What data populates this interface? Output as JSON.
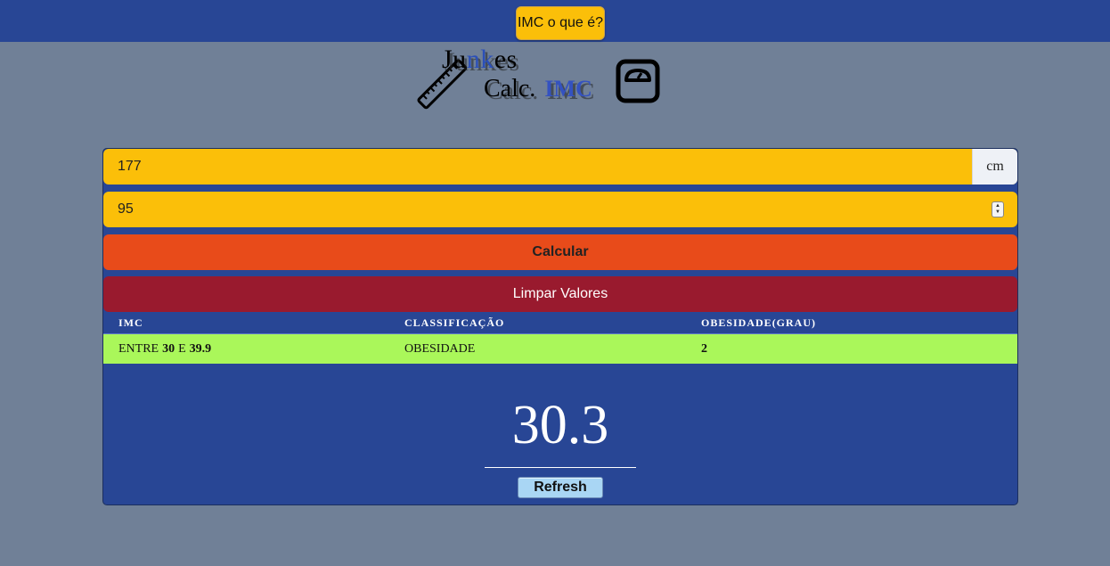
{
  "nav": {
    "imc_button_label": "IMC o que é?"
  },
  "logo": {
    "line1_a": "Ju",
    "line1_b": "nk",
    "line1_c": "es",
    "line2": "Calc.",
    "line2_imc": "IMC"
  },
  "form": {
    "height_value": "177",
    "height_unit": "cm",
    "weight_value": "95",
    "calc_label": "Calcular",
    "clear_label": "Limpar Valores"
  },
  "table": {
    "headers": [
      "IMC",
      "CLASSIFICAÇÃO",
      "OBESIDADE(GRAU)"
    ],
    "row": {
      "imc_prefix": "ENTRE",
      "imc_low": "30",
      "imc_mid": "E",
      "imc_high": "39.9",
      "classification": "OBESIDADE",
      "degree": "2"
    }
  },
  "result": {
    "value": "30.3",
    "refresh_label": "Refresh"
  },
  "colors": {
    "navy": "#284695",
    "background": "#708097",
    "amber": "#fbbf09",
    "calc_orange": "#e84b1a",
    "clear_red": "#991a2e",
    "row_green": "#aaf75a"
  },
  "icons": {
    "ruler": "ruler-icon",
    "scale": "bathroom-scale-icon"
  }
}
